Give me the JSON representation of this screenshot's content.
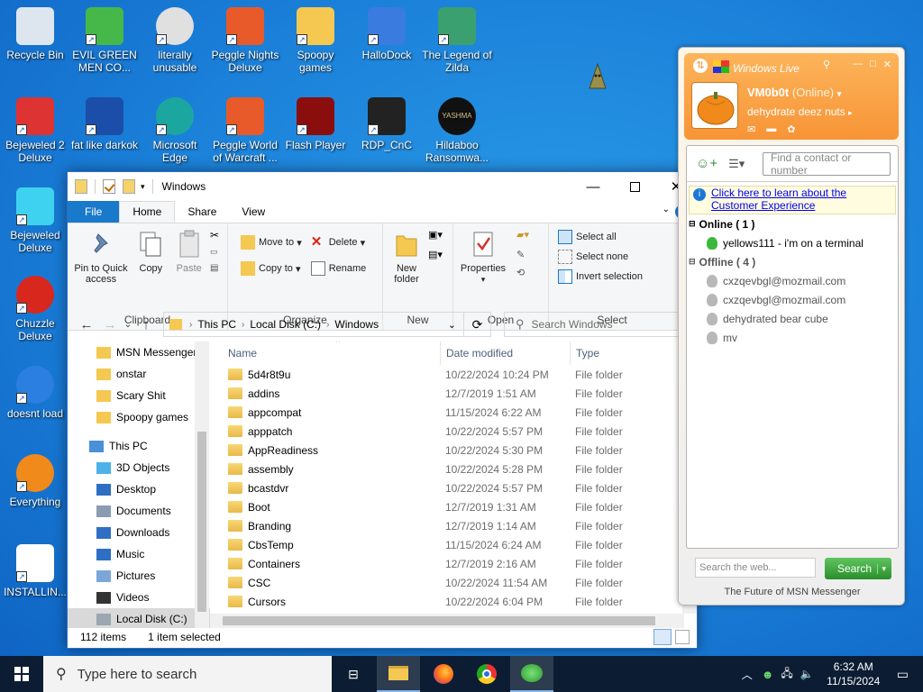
{
  "desktop": {
    "icons": [
      {
        "label": "Recycle Bin",
        "icon": "recycle-bin-icon"
      },
      {
        "label": "EVIL GREEN MEN CO...",
        "icon": "msn-buddy-icon"
      },
      {
        "label": "literally unusable",
        "icon": "chrome-icon"
      },
      {
        "label": "Peggle Nights Deluxe",
        "icon": "peggle-icon"
      },
      {
        "label": "Spoopy games",
        "icon": "folder-icon"
      },
      {
        "label": "HalloDock",
        "icon": "shield-icon"
      },
      {
        "label": "The Legend of Zilda",
        "icon": "game-character-icon"
      },
      {
        "label": "Bejeweled 2 Deluxe",
        "icon": "bejeweled-icon"
      },
      {
        "label": "fat like darkok",
        "icon": "mpl-icon"
      },
      {
        "label": "Microsoft Edge",
        "icon": "edge-icon"
      },
      {
        "label": "Peggle World of Warcraft ...",
        "icon": "peggle-icon"
      },
      {
        "label": "Flash Player",
        "icon": "flash-icon"
      },
      {
        "label": "RDP_CnC",
        "icon": "rdp-icon"
      },
      {
        "label": "Hildaboo Ransomwa...",
        "icon": "yashma-icon"
      },
      {
        "label": "Bejeweled Deluxe",
        "icon": "diamond-icon"
      },
      {
        "label": "Chuzzle Deluxe",
        "icon": "chuzzle-icon"
      },
      {
        "label": "doesnt load",
        "icon": "thunderbird-icon"
      },
      {
        "label": "Everything",
        "icon": "magnifier-icon"
      },
      {
        "label": "INSTALLIN...",
        "icon": "text-file-icon"
      }
    ],
    "mascot_text": "YASHMA"
  },
  "explorer": {
    "title": "Windows",
    "tabs": [
      "File",
      "Home",
      "Share",
      "View"
    ],
    "ribbon": {
      "clipboard": {
        "pin": "Pin to Quick access",
        "copy": "Copy",
        "paste": "Paste",
        "group": "Clipboard"
      },
      "organize": {
        "move_to": "Move to",
        "copy_to": "Copy to",
        "delete": "Delete",
        "rename": "Rename",
        "group": "Organize"
      },
      "new": {
        "new_folder": "New folder",
        "group": "New"
      },
      "open": {
        "properties": "Properties",
        "group": "Open"
      },
      "select": {
        "select_all": "Select all",
        "select_none": "Select none",
        "invert": "Invert selection",
        "group": "Select"
      }
    },
    "address": {
      "crumbs": [
        "This PC",
        "Local Disk (C:)",
        "Windows"
      ],
      "search_placeholder": "Search Windows"
    },
    "nav": [
      {
        "label": "MSN Messenger",
        "type": "folder",
        "indent": 1
      },
      {
        "label": "onstar",
        "type": "folder",
        "indent": 1
      },
      {
        "label": "Scary Shit",
        "type": "folder",
        "indent": 1
      },
      {
        "label": "Spoopy games",
        "type": "folder",
        "indent": 1
      },
      {
        "label": "",
        "type": "spacer",
        "indent": 0
      },
      {
        "label": "This PC",
        "type": "pc",
        "indent": 0
      },
      {
        "label": "3D Objects",
        "type": "3d",
        "indent": 1
      },
      {
        "label": "Desktop",
        "type": "desktop",
        "indent": 1
      },
      {
        "label": "Documents",
        "type": "docs",
        "indent": 1
      },
      {
        "label": "Downloads",
        "type": "downloads",
        "indent": 1
      },
      {
        "label": "Music",
        "type": "music",
        "indent": 1
      },
      {
        "label": "Pictures",
        "type": "pictures",
        "indent": 1
      },
      {
        "label": "Videos",
        "type": "videos",
        "indent": 1
      },
      {
        "label": "Local Disk (C:)",
        "type": "disk",
        "indent": 1,
        "selected": true
      }
    ],
    "columns": [
      "Name",
      "Date modified",
      "Type"
    ],
    "files": [
      {
        "name": "5d4r8t9u",
        "date": "10/22/2024 10:24 PM",
        "type": "File folder"
      },
      {
        "name": "addins",
        "date": "12/7/2019 1:51 AM",
        "type": "File folder"
      },
      {
        "name": "appcompat",
        "date": "11/15/2024 6:22 AM",
        "type": "File folder"
      },
      {
        "name": "apppatch",
        "date": "10/22/2024 5:57 PM",
        "type": "File folder"
      },
      {
        "name": "AppReadiness",
        "date": "10/22/2024 5:30 PM",
        "type": "File folder"
      },
      {
        "name": "assembly",
        "date": "10/22/2024 5:28 PM",
        "type": "File folder"
      },
      {
        "name": "bcastdvr",
        "date": "10/22/2024 5:57 PM",
        "type": "File folder"
      },
      {
        "name": "Boot",
        "date": "12/7/2019 1:31 AM",
        "type": "File folder"
      },
      {
        "name": "Branding",
        "date": "12/7/2019 1:14 AM",
        "type": "File folder"
      },
      {
        "name": "CbsTemp",
        "date": "11/15/2024 6:24 AM",
        "type": "File folder"
      },
      {
        "name": "Containers",
        "date": "12/7/2019 2:16 AM",
        "type": "File folder"
      },
      {
        "name": "CSC",
        "date": "10/22/2024 11:54 AM",
        "type": "File folder"
      },
      {
        "name": "Cursors",
        "date": "10/22/2024 6:04 PM",
        "type": "File folder"
      }
    ],
    "status": {
      "items": "112 items",
      "selected": "1 item selected"
    }
  },
  "msn": {
    "title": "Windows Live",
    "user": "VM0b0t",
    "status": "(Online)",
    "message": "dehydrate deez nuts",
    "find_placeholder": "Find a contact or number",
    "ad_text": "Click here to learn about the Customer Experience",
    "online_header": "Online ( 1 )",
    "online": [
      "yellows111 - i'm on a terminal"
    ],
    "offline_header": "Offline ( 4 )",
    "offline": [
      "cxzqevbgl@mozmail.com",
      "cxzqevbgl@mozmail.com",
      "dehydrated bear cube",
      "mv"
    ],
    "web_search_placeholder": "Search the web...",
    "search_label": "Search",
    "footer": "The Future of MSN Messenger"
  },
  "taskbar": {
    "search_placeholder": "Type here to search",
    "time": "6:32 AM",
    "date": "11/15/2024"
  },
  "colors": {
    "accent": "#1979ca",
    "msn_orange": "#f79436",
    "taskbar": "#0c1d33"
  }
}
